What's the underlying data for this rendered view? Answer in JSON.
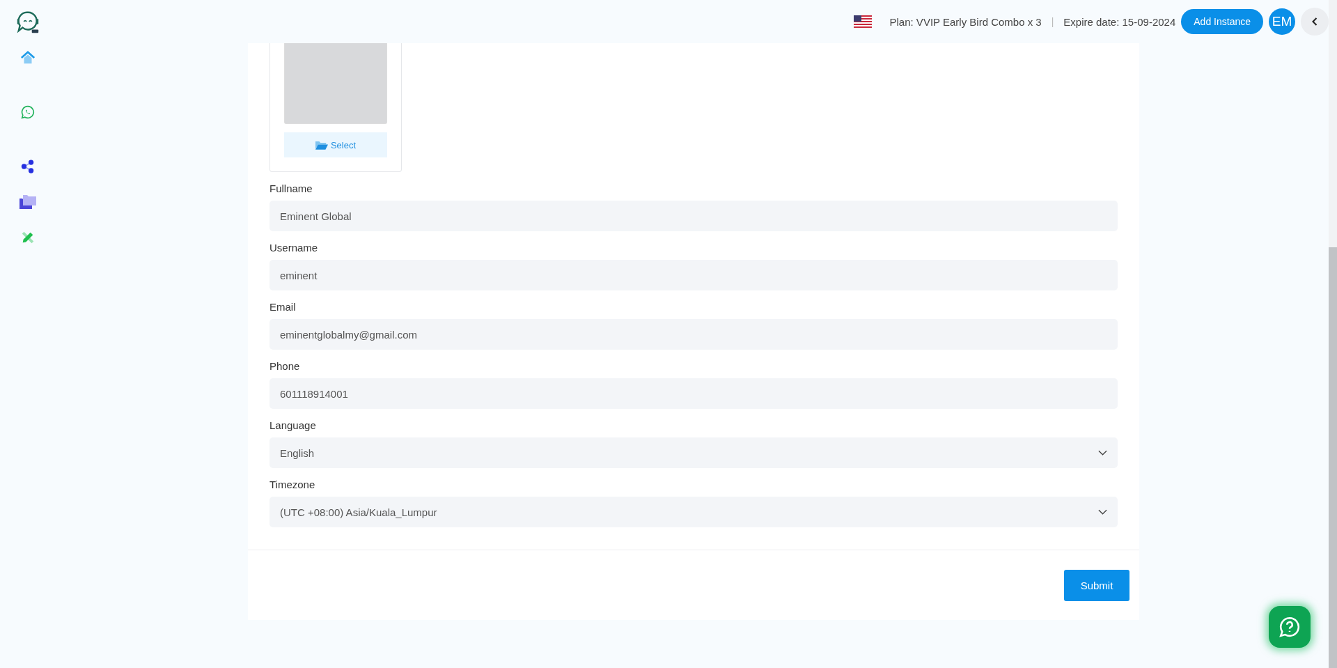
{
  "header": {
    "plan": "Plan: VVIP Early Bird Combo x 3",
    "separator": "|",
    "expire": "Expire date: 15-09-2024",
    "add_button": "Add Instance",
    "avatar": "EM"
  },
  "sidebar": {
    "items": [
      {
        "kind": "home"
      },
      {
        "kind": "whatsapp"
      },
      {
        "kind": "share"
      },
      {
        "kind": "folders"
      },
      {
        "kind": "pencil"
      }
    ]
  },
  "photo": {
    "select_button": "Select"
  },
  "fields": [
    {
      "label": "Fullname",
      "kind": "text",
      "value": "Eminent Global"
    },
    {
      "label": "Username",
      "kind": "text",
      "value": "eminent"
    },
    {
      "label": "Email",
      "kind": "text",
      "value": "eminentglobalmy@gmail.com"
    },
    {
      "label": "Phone",
      "kind": "text",
      "value": "601118914001"
    },
    {
      "label": "Language",
      "kind": "select",
      "value": "English"
    },
    {
      "label": "Timezone",
      "kind": "select",
      "value": "(UTC +08:00) Asia/Kuala_Lumpur"
    }
  ],
  "submit_button": "Submit"
}
